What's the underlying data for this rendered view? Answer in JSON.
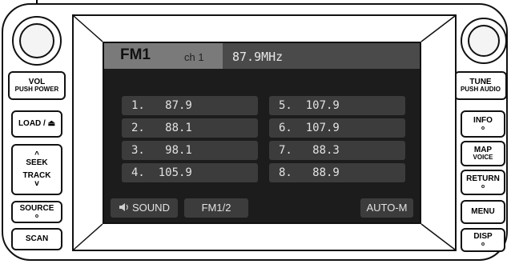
{
  "left_controls": {
    "vol_label": "VOL",
    "vol_sub": "PUSH POWER",
    "load_label": "LOAD / ⏏",
    "seek_label": "SEEK",
    "track_label": "TRACK",
    "seek_up_symbol": "^",
    "track_down_symbol": "v",
    "source_label": "SOURCE",
    "source_dot": "o",
    "scan_label": "SCAN"
  },
  "right_controls": {
    "tune_label": "TUNE",
    "tune_sub": "PUSH AUDIO",
    "info_label": "INFO",
    "info_dot": "o",
    "map_label": "MAP",
    "map_sub": "VOICE",
    "return_label": "RETURN",
    "return_dot": "o",
    "menu_label": "MENU",
    "disp_label": "DISP",
    "disp_dot": "o"
  },
  "screen": {
    "band": "FM1",
    "channel": "ch 1",
    "frequency": "87.9MHz",
    "presets_left": [
      {
        "text": "1.   87.9"
      },
      {
        "text": "2.   88.1"
      },
      {
        "text": "3.   98.1"
      },
      {
        "text": "4.  105.9"
      }
    ],
    "presets_right": [
      {
        "text": "5.  107.9"
      },
      {
        "text": "6.  107.9"
      },
      {
        "text": "7.   88.3"
      },
      {
        "text": "8.   88.9"
      }
    ],
    "sound_label": "SOUND",
    "band_toggle_label": "FM1/2",
    "auto_label": "AUTO-M"
  }
}
